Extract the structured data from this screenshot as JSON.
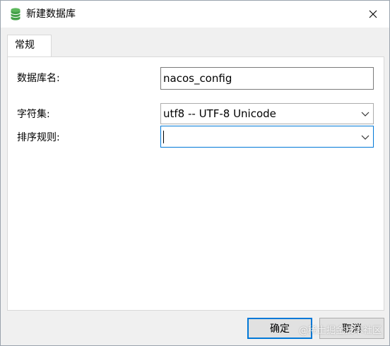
{
  "window": {
    "title": "新建数据库",
    "icon": "database-icon",
    "close_icon": "close-icon"
  },
  "tabs": [
    {
      "label": "常规",
      "active": true
    }
  ],
  "form": {
    "db_name_label": "数据库名:",
    "db_name_value": "nacos_config",
    "charset_label": "字符集:",
    "charset_value": "utf8 -- UTF-8 Unicode",
    "collation_label": "排序规则:",
    "collation_value": ""
  },
  "buttons": {
    "ok_label": "确定",
    "cancel_label": "取消"
  },
  "watermark": "@稀土掘金技术社区",
  "colors": {
    "accent": "#0078d7",
    "db_icon_green": "#4caf50"
  }
}
